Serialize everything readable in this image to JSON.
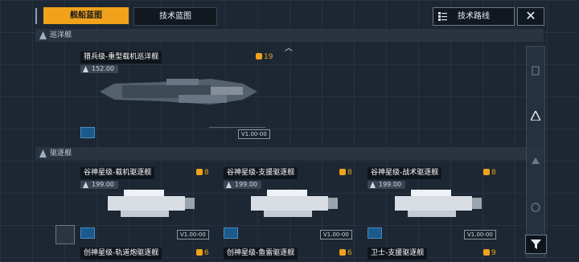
{
  "tabs": [
    {
      "label": "舰船蓝图",
      "active": true
    },
    {
      "label": "技术蓝图",
      "active": false
    }
  ],
  "toolbar": {
    "tech_route_label": "技术路线",
    "close_icon": "✕"
  },
  "sections": [
    {
      "label": "巡洋舰"
    },
    {
      "label": "驱逐舰"
    }
  ],
  "cruiser_card": {
    "title": "猎兵级-重型载机巡洋舰",
    "cost": "19",
    "stat": "152.00",
    "code": "V1.00-00"
  },
  "destroyer_cards": [
    {
      "title": "谷神星级-载机驱逐舰",
      "cost": "8",
      "stat": "199.00",
      "code": "V1.00-00"
    },
    {
      "title": "谷神星级-支援驱逐舰",
      "cost": "8",
      "stat": "199.00",
      "code": "V1.00-00"
    },
    {
      "title": "谷神星级-战术驱逐舰",
      "cost": "8",
      "stat": "199.00",
      "code": "V1.00-00"
    }
  ],
  "bottom_cards": [
    {
      "title": "创神星级-轨道炮驱逐舰",
      "cost": "6"
    },
    {
      "title": "创神星级-鱼雷驱逐舰",
      "cost": "6"
    },
    {
      "title": "卫士-支援驱逐舰",
      "cost": "9"
    }
  ],
  "colors": {
    "accent": "#f0a21a",
    "background": "#1d2733",
    "badge_blue": "#1b5a8c"
  }
}
